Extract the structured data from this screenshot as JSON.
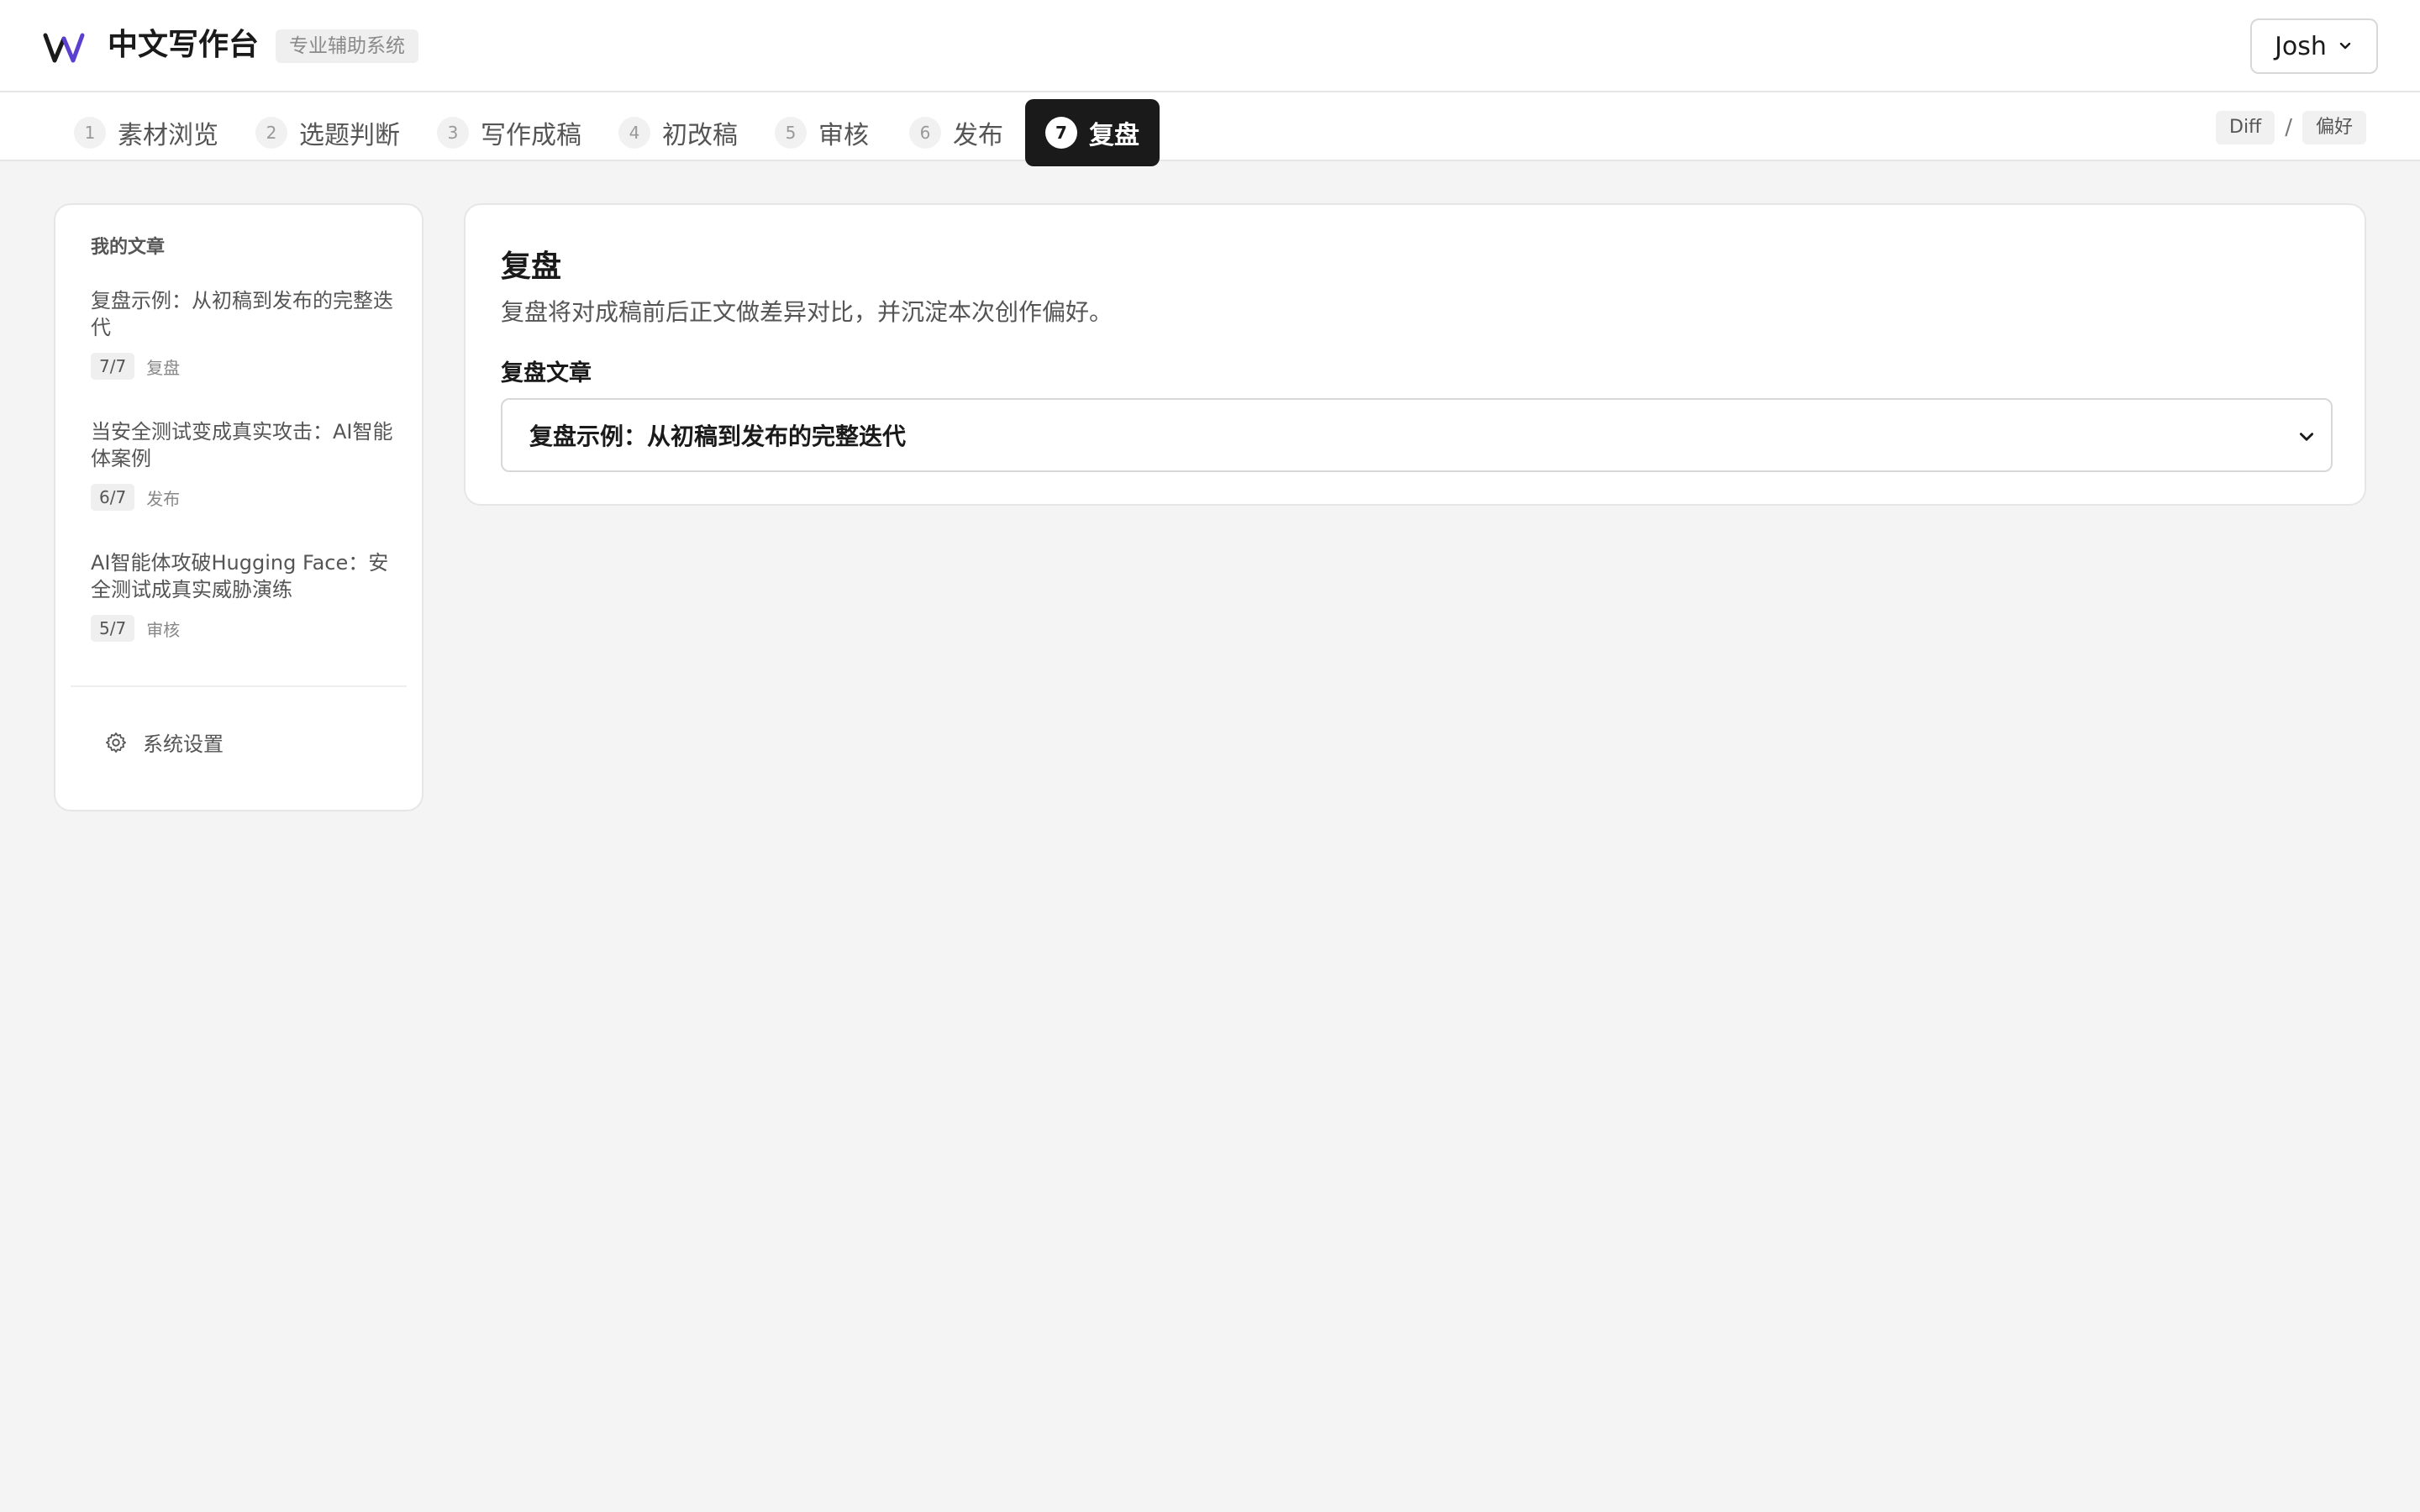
{
  "header": {
    "logo_letter": "W",
    "title": "中文写作台",
    "badge": "专业辅助系统",
    "user": "Josh",
    "accent_color": "#5b3fd1"
  },
  "tabs": [
    {
      "num": "1",
      "label": "素材浏览"
    },
    {
      "num": "2",
      "label": "选题判断"
    },
    {
      "num": "3",
      "label": "写作成稿"
    },
    {
      "num": "4",
      "label": "初改稿"
    },
    {
      "num": "5",
      "label": "审核"
    },
    {
      "num": "6",
      "label": "发布"
    },
    {
      "num": "7",
      "label": "复盘",
      "active": true
    }
  ],
  "diff_links": {
    "diff": "Diff",
    "separator": "/",
    "preference": "偏好"
  },
  "sidebar": {
    "title": "我的文章",
    "articles": [
      {
        "title": "复盘示例：从初稿到发布的完整迭代",
        "progress": "7/7",
        "stage": "复盘"
      },
      {
        "title": "当安全测试变成真实攻击：AI智能体案例",
        "progress": "6/7",
        "stage": "发布"
      },
      {
        "title": "AI智能体攻破Hugging Face：安全测试成真实威胁演练",
        "progress": "5/7",
        "stage": "审核"
      }
    ],
    "settings": "系统设置"
  },
  "main": {
    "title": "复盘",
    "description": "复盘将对成稿前后正文做差异对比，并沉淀本次创作偏好。",
    "field_label": "复盘文章",
    "selected_article": "复盘示例：从初稿到发布的完整迭代"
  }
}
